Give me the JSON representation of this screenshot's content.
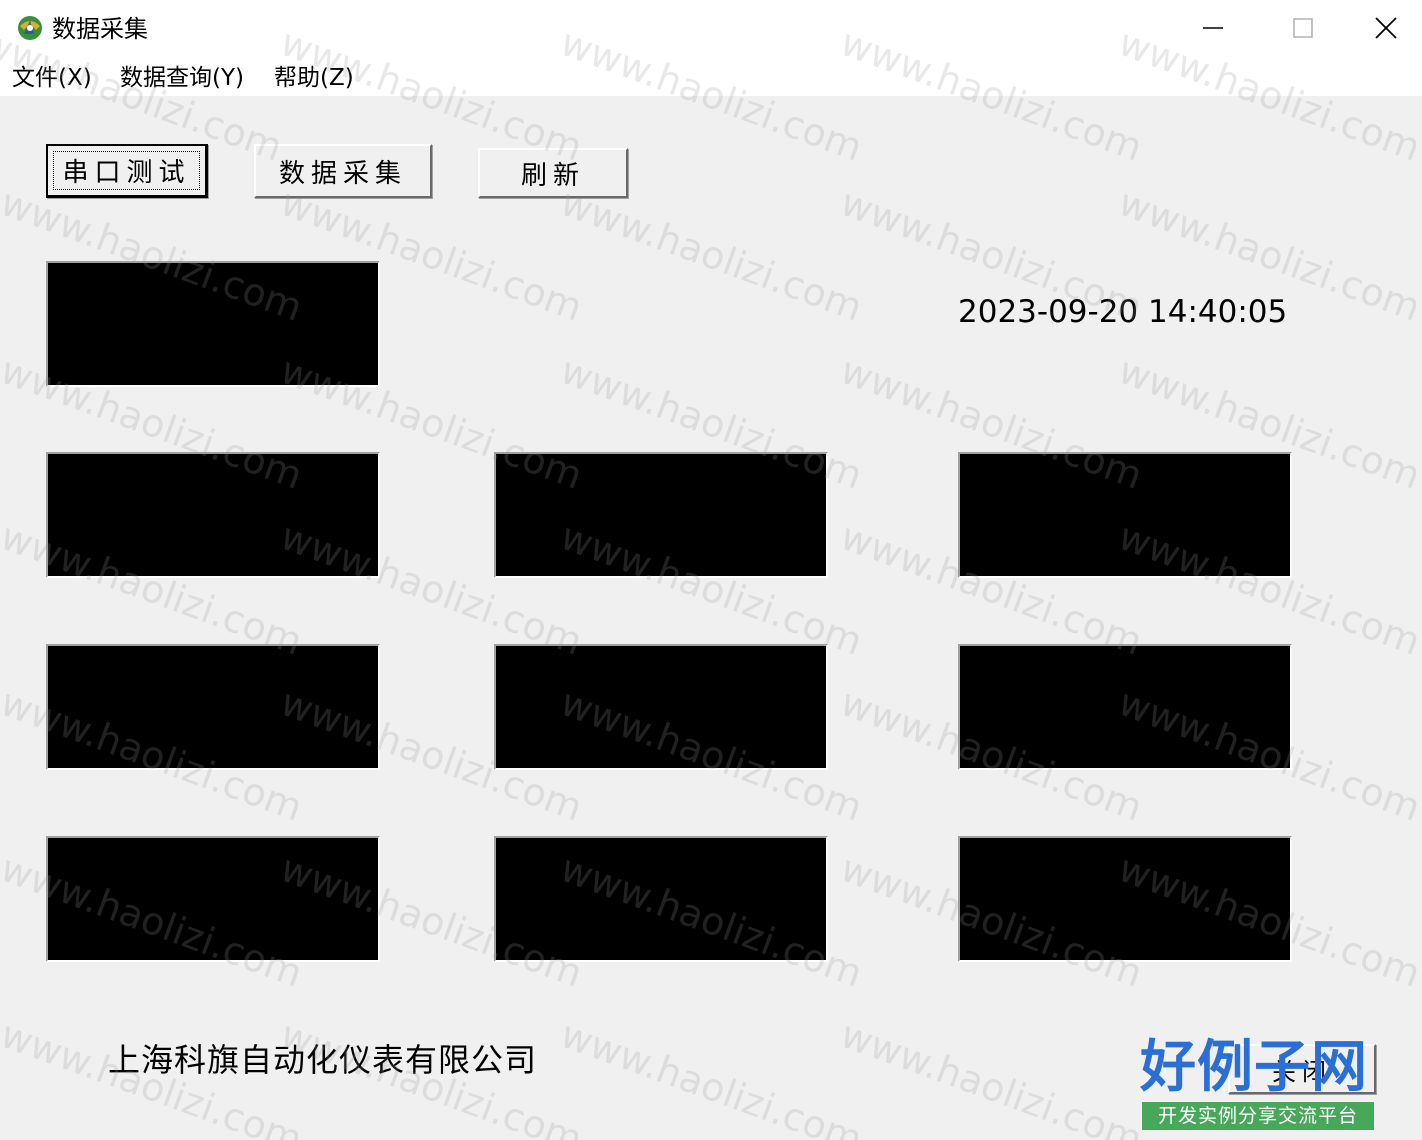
{
  "window": {
    "title": "数据采集",
    "controls": {
      "minimize": "minimize-icon",
      "maximize": "maximize-icon",
      "close": "close-icon"
    }
  },
  "menu": [
    {
      "label": "文件(X)"
    },
    {
      "label": "数据查询(Y)"
    },
    {
      "label": "帮助(Z)"
    }
  ],
  "toolbar": {
    "serial_test": "串口测试",
    "data_collect": "数据采集",
    "refresh": "刷新"
  },
  "datetime": "2023-09-20 14:40:05",
  "company": "上海科旗自动化仪表有限公司",
  "footer": {
    "close_label": "关闭"
  },
  "watermark": {
    "text": "www.haolizi.com",
    "logo_main": "好例子网",
    "logo_sub": "开发实例分享交流平台",
    "logo_color": "#2a6fd6",
    "logo_sub_bg": "#48a85a"
  },
  "colors": {
    "panel": "#000000",
    "background": "#f0f0f0"
  }
}
